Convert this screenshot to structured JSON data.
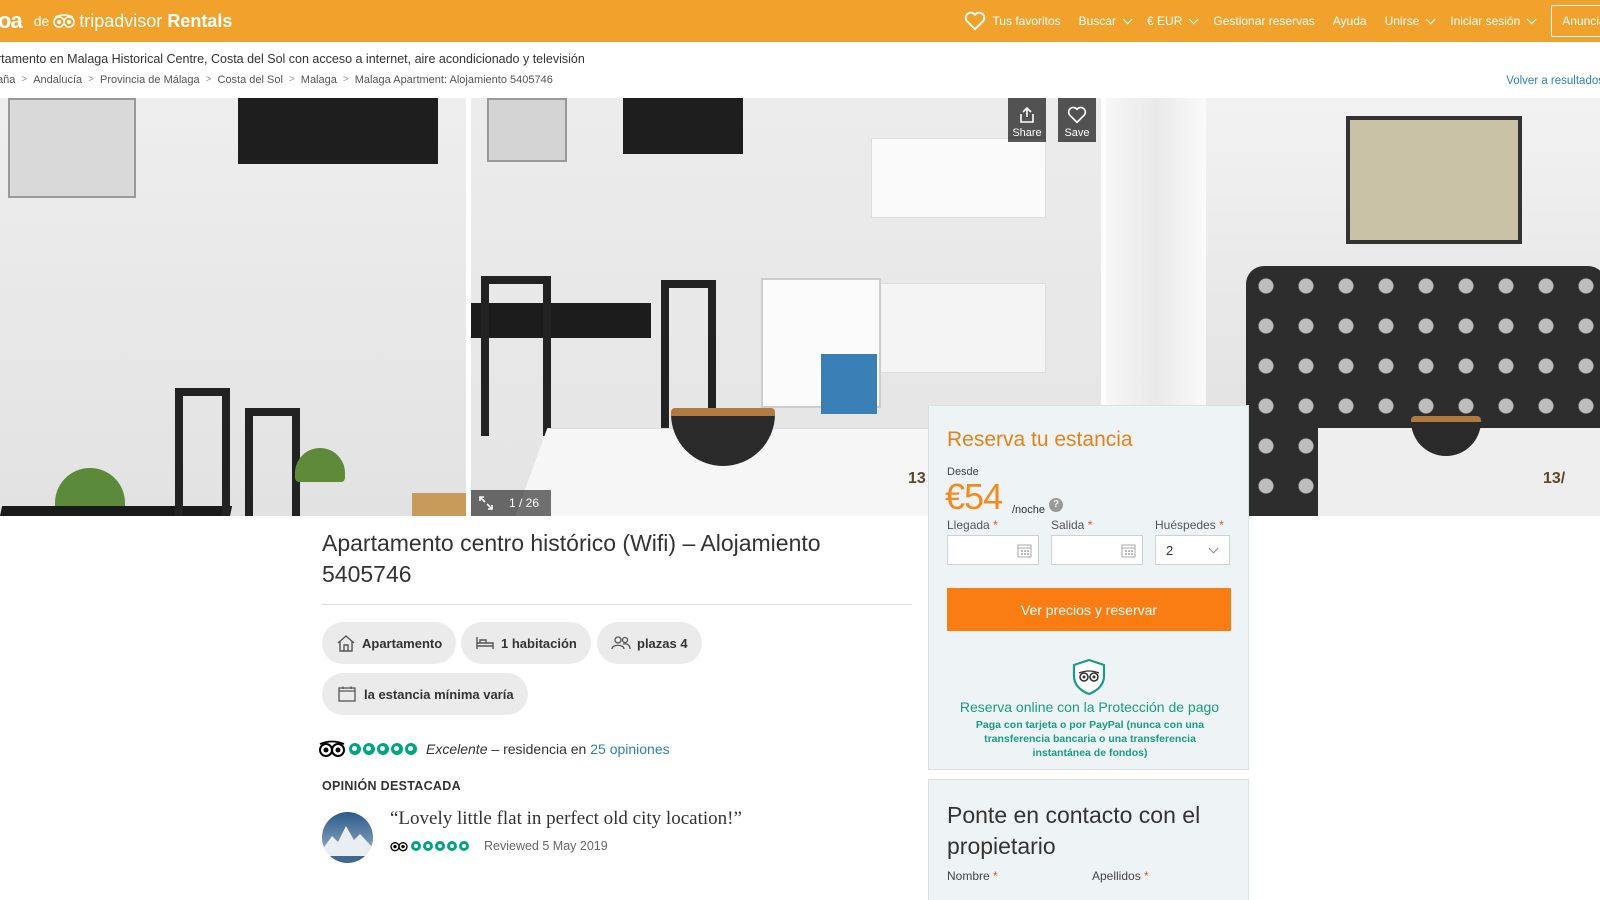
{
  "header": {
    "logo_cut": "oa",
    "logo_de": "de",
    "logo_brand": "tripadvisor",
    "logo_brand_suffix": "Rentals",
    "nav": {
      "favorites": "Tus favoritos",
      "search": "Buscar",
      "currency": "€ EUR",
      "manage": "Gestionar reservas",
      "help": "Ayuda",
      "join": "Unirse",
      "login": "Iniciar sesión",
      "advertise": "Anuncia tu"
    }
  },
  "subtitle": "rtamento en Malaga Historical Centre, Costa del Sol con acceso a internet, aire acondicionado y televisión",
  "breadcrumb": [
    "aña",
    "Andalucía",
    "Provincia de Málaga",
    "Costa del Sol",
    "Malaga",
    "Malaga Apartment: Alojamiento 5405746"
  ],
  "breadcrumb_sep": ">",
  "back_link": "Volver a resultados",
  "gallery": {
    "counter": "1 / 26",
    "share": "Share",
    "save": "Save",
    "edge_left": "13",
    "edge_right": "13/"
  },
  "booking": {
    "title": "Reserva tu estancia",
    "from": "Desde",
    "price": "€54",
    "per_night": "/noche",
    "help": "?",
    "arrival_label": "Llegada",
    "departure_label": "Salida",
    "guests_label": "Huéspedes",
    "required": "*",
    "arrival_value": "",
    "departure_value": "",
    "guests_value": "2",
    "cta": "Ver precios y reservar",
    "protect_title": "Reserva online con la Protección de pago",
    "protect_sub": "Paga con tarjeta o por PayPal (nunca con una transferencia bancaria o una transferencia instantánea de fondos)"
  },
  "contact": {
    "title": "Ponte en contacto con el propietario",
    "name_label": "Nombre",
    "surname_label": "Apellidos",
    "required": "*"
  },
  "listing": {
    "title": "Apartamento centro histórico (Wifi) – Alojamiento 5405746",
    "chips": {
      "type": "Apartamento",
      "rooms": "1 habitación",
      "capacity": "plazas 4",
      "min_stay": "la estancia mínima varía"
    },
    "rating": {
      "score": 5,
      "max": 5,
      "label": "Excelente",
      "dash": "–",
      "text": "residencia en",
      "reviews_link": "25 opiniones"
    },
    "featured_heading": "OPINIÓN DESTACADA",
    "featured_quote": "“Lovely little flat in perfect old city location!”",
    "featured_score": 5,
    "featured_date": "Reviewed 5 May 2019"
  },
  "colors": {
    "brand": "#f0a22d",
    "cta": "#f97d13",
    "price": "#f28b1f",
    "green": "#00a680",
    "link": "#2d7fb8"
  }
}
